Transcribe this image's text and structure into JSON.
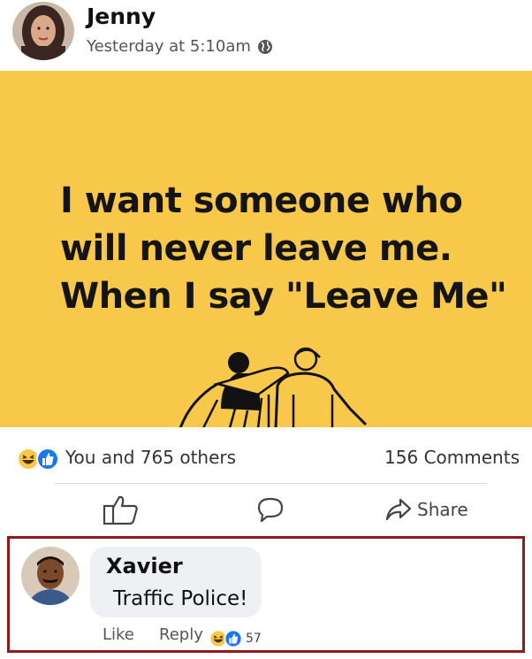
{
  "post": {
    "author": "Jenny",
    "timestamp": "Yesterday at 5:10am",
    "privacy_icon": "globe-icon",
    "image_text": {
      "line1": "I want someone who",
      "line2": "will never leave me.",
      "line3": "When I say \"Leave Me\""
    },
    "image_bg_color": "#f8c84a"
  },
  "reactions": {
    "icons": [
      "laugh-react-icon",
      "like-react-icon"
    ],
    "summary": "You and 765 others",
    "comments": "156 Comments"
  },
  "actions": {
    "like_icon": "thumbs-up-icon",
    "comment_icon": "comment-bubble-icon",
    "share_label": "Share"
  },
  "comment": {
    "author": "Xavier",
    "text": "Traffic Police!",
    "like_label": "Like",
    "reply_label": "Reply",
    "reaction_count": "57",
    "highlight_color": "#8f1a1a"
  }
}
